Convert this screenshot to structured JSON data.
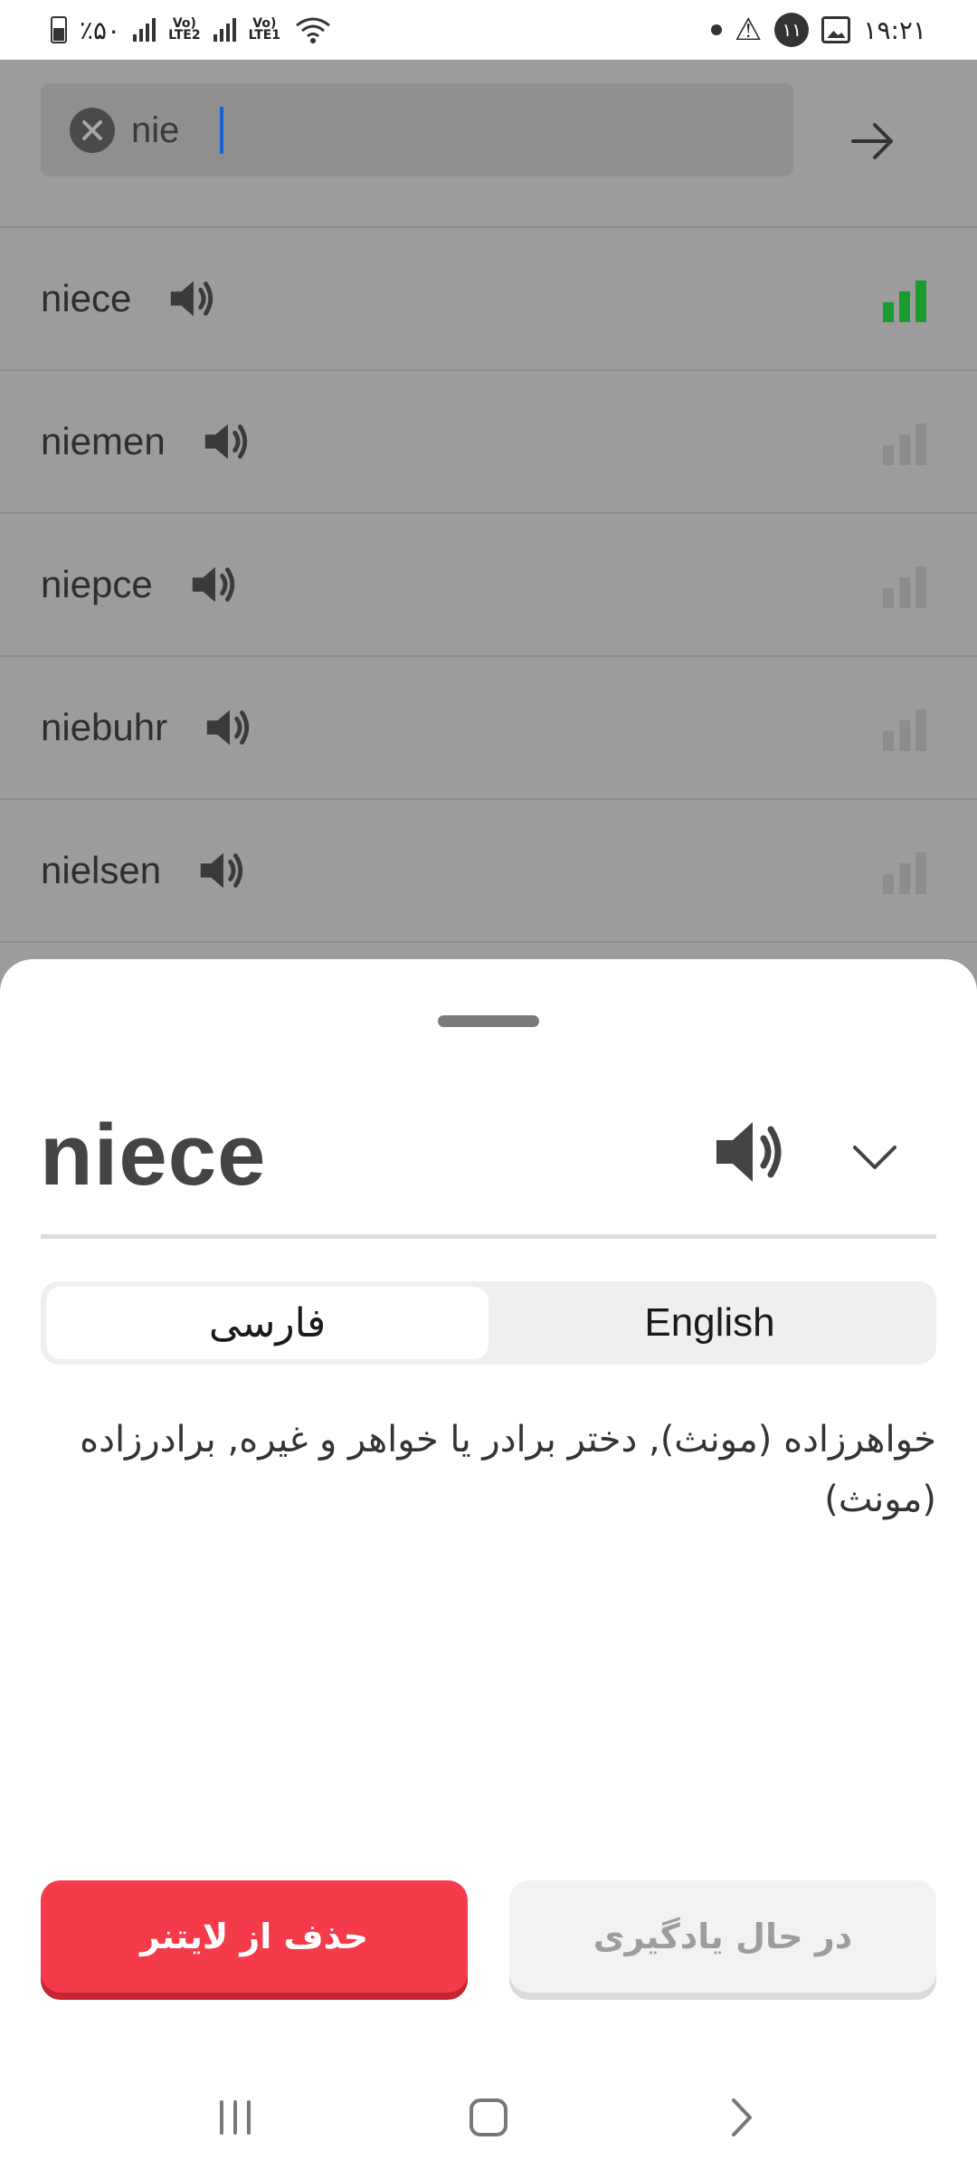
{
  "status_bar": {
    "battery_text": "٪۵۰",
    "network_1": "LTE2",
    "network_2": "LTE1",
    "notification_count": "۱۱",
    "time": "۱۹:۲۱"
  },
  "search": {
    "value": "nie"
  },
  "suggestions": [
    {
      "word": "niece",
      "active": true
    },
    {
      "word": "niemen",
      "active": false
    },
    {
      "word": "niepce",
      "active": false
    },
    {
      "word": "niebuhr",
      "active": false
    },
    {
      "word": "nielsen",
      "active": false
    }
  ],
  "detail": {
    "headword": "niece",
    "tabs": {
      "persian": "فارسی",
      "english": "English"
    },
    "definition": "خواهرزاده (مونث), دختر برادر یا خواهر و غیره, برادرزاده (مونث)",
    "remove_button": "حذف از لایتنر",
    "learning_button": "در حال یادگیری"
  },
  "colors": {
    "accent_red": "#f53b4a",
    "level_green": "#1b9a2e",
    "level_inactive": "#8c8c8c"
  }
}
